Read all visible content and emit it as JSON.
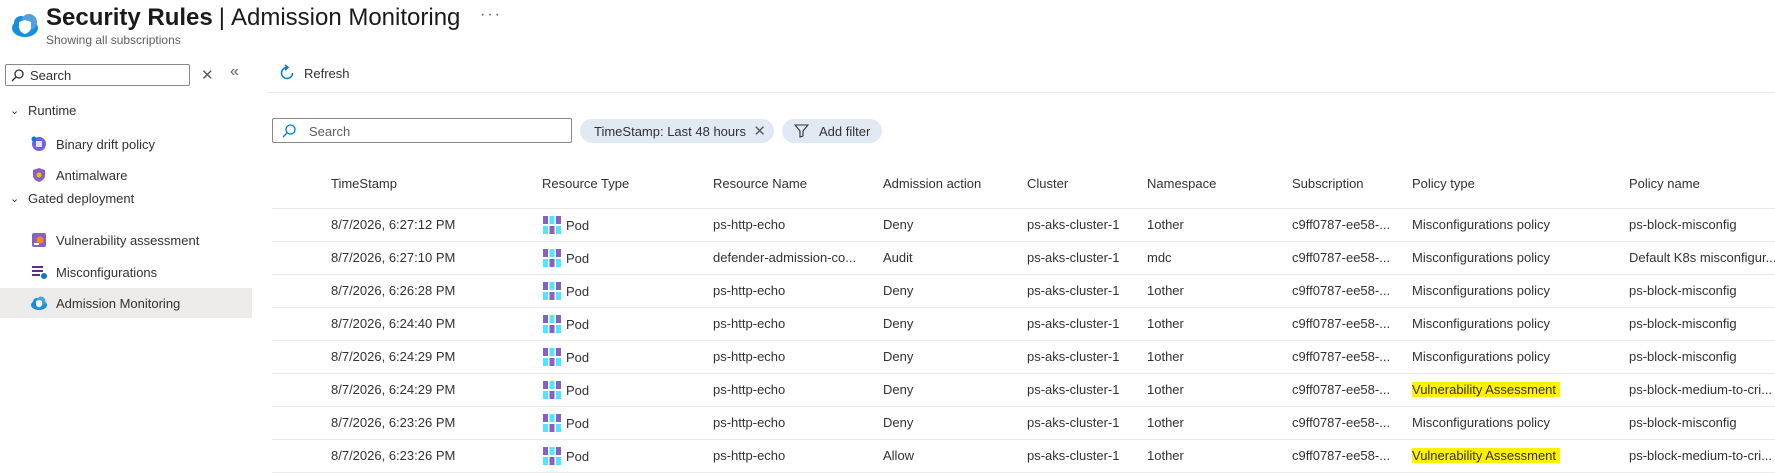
{
  "header": {
    "title_main": "Security Rules",
    "title_separator": "|",
    "title_sub": "Admission Monitoring",
    "subtitle": "Showing all subscriptions",
    "more_label": "···"
  },
  "sidebar": {
    "search_placeholder": "Search",
    "clear_label": "✕",
    "collapse_label": "«",
    "groups": [
      {
        "label": "Runtime",
        "items": [
          {
            "label": "Binary drift policy"
          },
          {
            "label": "Antimalware"
          }
        ]
      },
      {
        "label": "Gated deployment",
        "items": [
          {
            "label": "Vulnerability assessment"
          },
          {
            "label": "Misconfigurations"
          },
          {
            "label": "Admission Monitoring",
            "active": true
          }
        ]
      }
    ]
  },
  "toolbar": {
    "refresh_label": "Refresh"
  },
  "filters": {
    "search_placeholder": "Search",
    "timestamp_pill": "TimeStamp: Last 48 hours",
    "remove_label": "✕",
    "add_filter_label": "Add filter"
  },
  "table": {
    "columns": [
      "TimeStamp",
      "Resource Type",
      "Resource Name",
      "Admission action",
      "Cluster",
      "Namespace",
      "Subscription",
      "Policy type",
      "Policy name"
    ],
    "rows": [
      {
        "timestamp": "8/7/2026, 6:27:12 PM",
        "resource_type": "Pod",
        "resource_name": "ps-http-echo",
        "action": "Deny",
        "cluster": "ps-aks-cluster-1",
        "namespace": "1other",
        "subscription": "c9ff0787-ee58-...",
        "policy_type": "Misconfigurations policy",
        "policy_name": "ps-block-misconfig",
        "highlight": false
      },
      {
        "timestamp": "8/7/2026, 6:27:10 PM",
        "resource_type": "Pod",
        "resource_name": "defender-admission-co...",
        "action": "Audit",
        "cluster": "ps-aks-cluster-1",
        "namespace": "mdc",
        "subscription": "c9ff0787-ee58-...",
        "policy_type": "Misconfigurations policy",
        "policy_name": "Default K8s misconfigur...",
        "highlight": false
      },
      {
        "timestamp": "8/7/2026, 6:26:28 PM",
        "resource_type": "Pod",
        "resource_name": "ps-http-echo",
        "action": "Deny",
        "cluster": "ps-aks-cluster-1",
        "namespace": "1other",
        "subscription": "c9ff0787-ee58-...",
        "policy_type": "Misconfigurations policy",
        "policy_name": "ps-block-misconfig",
        "highlight": false
      },
      {
        "timestamp": "8/7/2026, 6:24:40 PM",
        "resource_type": "Pod",
        "resource_name": "ps-http-echo",
        "action": "Deny",
        "cluster": "ps-aks-cluster-1",
        "namespace": "1other",
        "subscription": "c9ff0787-ee58-...",
        "policy_type": "Misconfigurations policy",
        "policy_name": "ps-block-misconfig",
        "highlight": false
      },
      {
        "timestamp": "8/7/2026, 6:24:29 PM",
        "resource_type": "Pod",
        "resource_name": "ps-http-echo",
        "action": "Deny",
        "cluster": "ps-aks-cluster-1",
        "namespace": "1other",
        "subscription": "c9ff0787-ee58-...",
        "policy_type": "Misconfigurations policy",
        "policy_name": "ps-block-misconfig",
        "highlight": false
      },
      {
        "timestamp": "8/7/2026, 6:24:29 PM",
        "resource_type": "Pod",
        "resource_name": "ps-http-echo",
        "action": "Deny",
        "cluster": "ps-aks-cluster-1",
        "namespace": "1other",
        "subscription": "c9ff0787-ee58-...",
        "policy_type": "Vulnerability Assessment",
        "policy_name": "ps-block-medium-to-cri...",
        "highlight": true
      },
      {
        "timestamp": "8/7/2026, 6:23:26 PM",
        "resource_type": "Pod",
        "resource_name": "ps-http-echo",
        "action": "Deny",
        "cluster": "ps-aks-cluster-1",
        "namespace": "1other",
        "subscription": "c9ff0787-ee58-...",
        "policy_type": "Misconfigurations policy",
        "policy_name": "ps-block-misconfig",
        "highlight": false
      },
      {
        "timestamp": "8/7/2026, 6:23:26 PM",
        "resource_type": "Pod",
        "resource_name": "ps-http-echo",
        "action": "Allow",
        "cluster": "ps-aks-cluster-1",
        "namespace": "1other",
        "subscription": "c9ff0787-ee58-...",
        "policy_type": "Vulnerability Assessment",
        "policy_name": "ps-block-medium-to-cri...",
        "highlight": true
      }
    ]
  },
  "colors": {
    "accent": "#0078d4",
    "highlight": "#fff100",
    "active_bg": "#edebe9"
  },
  "icons": [
    "cloud-shield-icon",
    "search-icon",
    "close-icon",
    "collapse-icon",
    "chevron-down-icon",
    "binary-drift-icon",
    "antimalware-icon",
    "vulnerability-icon",
    "misconfig-icon",
    "admission-icon",
    "refresh-icon",
    "filter-icon",
    "pod-icon"
  ]
}
